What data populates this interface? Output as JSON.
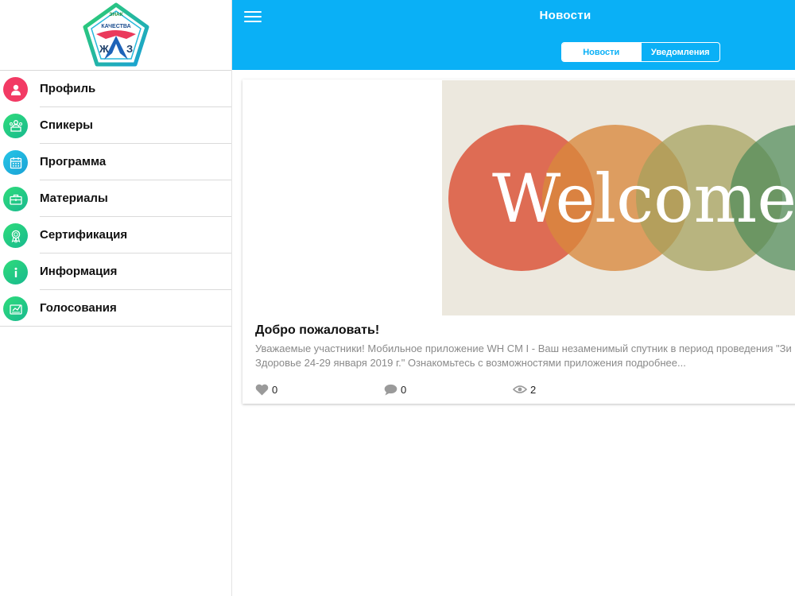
{
  "app": {
    "logo": {
      "top_text": "ЗНАК",
      "sub_text": "КАЧЕСТВА",
      "letters": [
        "Ж",
        "З"
      ]
    }
  },
  "sidebar": {
    "items": [
      {
        "label": "Профиль",
        "icon": "profile-icon"
      },
      {
        "label": "Спикеры",
        "icon": "speakers-icon"
      },
      {
        "label": "Программа",
        "icon": "calendar-icon"
      },
      {
        "label": "Материалы",
        "icon": "briefcase-icon"
      },
      {
        "label": "Сертификация",
        "icon": "certificate-icon"
      },
      {
        "label": "Информация",
        "icon": "info-icon"
      },
      {
        "label": "Голосования",
        "icon": "vote-icon"
      }
    ]
  },
  "header": {
    "title": "Новости",
    "tabs": [
      {
        "label": "Новости",
        "active": true
      },
      {
        "label": "Уведомления",
        "active": false
      }
    ]
  },
  "news": [
    {
      "image_text": "Welcome",
      "title": "Добро пожаловать!",
      "excerpt_line1": "Уважаемые участники! Мобильное приложение WH CM I - Ваш незаменимый спутник в период проведения \"Зи",
      "excerpt_line2": "Здоровье 24-29 января 2019 г.\" Ознакомьтесь с возможностями приложения подробнее...",
      "likes": "0",
      "comments": "0",
      "views": "2"
    }
  ],
  "colors": {
    "header_bg": "#0ab0f6",
    "profile_icon_bg": "#f23a64",
    "accent_green": "#22c97f",
    "accent_blue": "#1fb3e0"
  }
}
